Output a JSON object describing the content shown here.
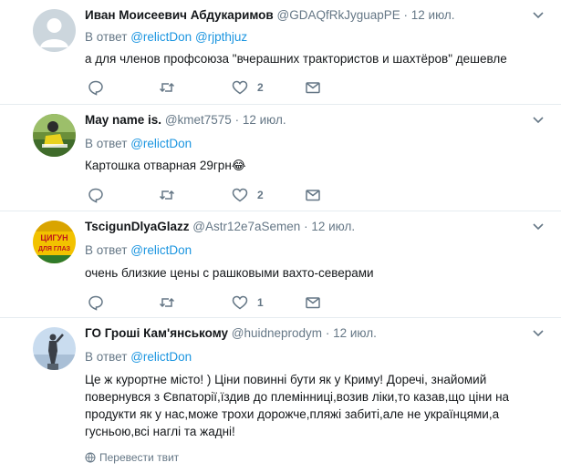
{
  "colors": {
    "link": "#1b95e0",
    "muted": "#657786",
    "text": "#14171a",
    "divider": "#e6ecf0"
  },
  "tweets": [
    {
      "name": "Иван Моисеевич Абдукаримов",
      "handle": "@GDAQfRkJyguapPE",
      "time": "12 июл.",
      "reply_prefix": "В ответ",
      "mentions": [
        "@relictDon",
        "@rjpthjuz"
      ],
      "text": "а для членов профсоюза \"вчерашних трактористов и шахтёров\" дешевле",
      "likes": "2",
      "avatar": "default-egg-avatar"
    },
    {
      "name": "May name is.",
      "handle": "@kmet7575",
      "time": "12 июл.",
      "reply_prefix": "В ответ",
      "mentions": [
        "@relictDon"
      ],
      "text": "Картошка отварная 29грн",
      "emoji": "😂",
      "likes": "2",
      "avatar": "photo-avatar"
    },
    {
      "name": "TscigunDlyaGlazz",
      "handle": "@Astr12e7aSemen",
      "time": "12 июл.",
      "reply_prefix": "В ответ",
      "mentions": [
        "@relictDon"
      ],
      "text": "очень близкие цены с рашковыми вахто-северами",
      "likes": "1",
      "avatar_lines": [
        "ЦИГУН",
        "ДЛЯ ГЛАЗ"
      ]
    },
    {
      "name": "ГО Гроші Кам'янському",
      "handle": "@huidneprodym",
      "time": "12 июл.",
      "reply_prefix": "В ответ",
      "mentions": [
        "@relictDon"
      ],
      "text_lines": [
        "Це ж курортне місто! ) Ціни повинні бути як у Криму! Доречі, знайомий",
        "повернувся з Євпаторії,їздив до племінниці,возив ліки,то казав,що ціни на",
        "продукти як у нас,може трохи дорожче,пляжі забиті,але не українцями,а",
        "гусньою,всі наглі та жадні!"
      ],
      "translate_label": "Перевести твит",
      "avatar": "statue-avatar"
    }
  ],
  "dot": "·"
}
